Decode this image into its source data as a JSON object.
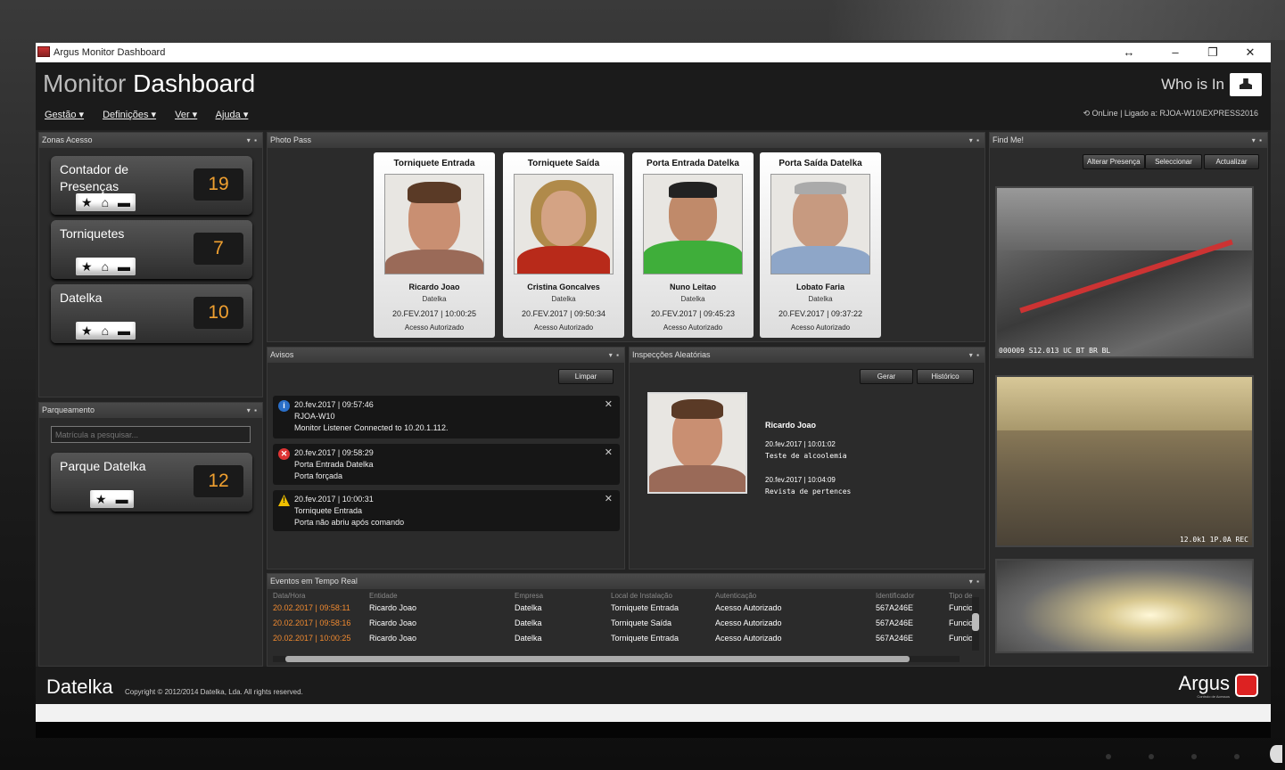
{
  "window": {
    "title": "Argus Monitor Dashboard"
  },
  "header": {
    "brand_light": "Monitor",
    "brand_bold": "Dashboard",
    "menu": [
      "Gestão",
      "Definições",
      "Ver",
      "Ajuda"
    ],
    "who_is_in": "Who is In",
    "status": "OnLine | Ligado a: RJOA-W10\\EXPRESS2016"
  },
  "zonas": {
    "title": "Zonas Acesso",
    "tiles": [
      {
        "label": "Contador de Presenças",
        "count": "19"
      },
      {
        "label": "Torniquetes",
        "count": "7"
      },
      {
        "label": "Datelka",
        "count": "10"
      }
    ]
  },
  "parqueamento": {
    "title": "Parqueamento",
    "search_placeholder": "Matrícula a pesquisar...",
    "tile": {
      "label": "Parque Datelka",
      "count": "12"
    }
  },
  "photo_pass": {
    "title": "Photo Pass",
    "cards": [
      {
        "location": "Torniquete Entrada",
        "name": "Ricardo Joao",
        "company": "Datelka",
        "datetime": "20.FEV.2017 | 10:00:25",
        "status": "Acesso Autorizado"
      },
      {
        "location": "Torniquete Saída",
        "name": "Cristina Goncalves",
        "company": "Datelka",
        "datetime": "20.FEV.2017 | 09:50:34",
        "status": "Acesso Autorizado"
      },
      {
        "location": "Porta Entrada Datelka",
        "name": "Nuno Leitao",
        "company": "Datelka",
        "datetime": "20.FEV.2017 | 09:45:23",
        "status": "Acesso Autorizado"
      },
      {
        "location": "Porta Saída Datelka",
        "name": "Lobato Faria",
        "company": "Datelka",
        "datetime": "20.FEV.2017 | 09:37:22",
        "status": "Acesso Autorizado"
      }
    ]
  },
  "avisos": {
    "title": "Avisos",
    "clear_label": "Limpar",
    "items": [
      {
        "type": "info",
        "time": "20.fev.2017 | 09:57:46",
        "line1": "RJOA-W10",
        "line2": "Monitor Listener Connected to 10.20.1.112."
      },
      {
        "type": "error",
        "time": "20.fev.2017 | 09:58:29",
        "line1": "Porta Entrada Datelka",
        "line2": "Porta forçada"
      },
      {
        "type": "warning",
        "time": "20.fev.2017 | 10:00:31",
        "line1": "Torniquete Entrada",
        "line2": "Porta não abriu após comando"
      }
    ]
  },
  "inspeccoes": {
    "title": "Inspecções Aleatórias",
    "generate_label": "Gerar",
    "history_label": "Histórico",
    "person": "Ricardo Joao",
    "entries": [
      {
        "time": "20.fev.2017 | 10:01:02",
        "desc": "Teste de alcoolemia"
      },
      {
        "time": "20.fev.2017 | 10:04:09",
        "desc": "Revista de pertences"
      }
    ]
  },
  "eventos": {
    "title": "Eventos em Tempo Real",
    "columns": [
      "Data/Hora",
      "Entidade",
      "Empresa",
      "Local de Instalação",
      "Autenticação",
      "Identificador",
      "Tipo de"
    ],
    "rows": [
      [
        "20.02.2017 | 09:58:11",
        "Ricardo Joao",
        "Datelka",
        "Torniquete Entrada",
        "Acesso Autorizado",
        "567A246E",
        "Funcio"
      ],
      [
        "20.02.2017 | 09:58:16",
        "Ricardo Joao",
        "Datelka",
        "Torniquete Saída",
        "Acesso Autorizado",
        "567A246E",
        "Funcio"
      ],
      [
        "20.02.2017 | 10:00:25",
        "Ricardo Joao",
        "Datelka",
        "Torniquete Entrada",
        "Acesso Autorizado",
        "567A246E",
        "Funcio"
      ]
    ]
  },
  "find_me": {
    "title": "Find Me!",
    "buttons": [
      "Alterar Presença",
      "Seleccionar",
      "Actualizar"
    ],
    "cam1_overlay": "000009 S12.013 UC BT BR BL",
    "cam2_overlay": "12.0k1 1P.0A REC"
  },
  "footer": {
    "logo": "Datelka",
    "copyright": "Copyright © 2012/2014 Datelka, Lda. All rights reserved.",
    "argus": "Argus",
    "argus_sub": "Controlo de Acessos"
  }
}
